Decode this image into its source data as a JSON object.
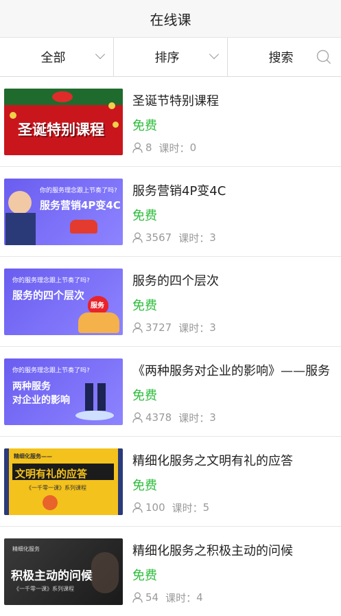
{
  "header": {
    "title": "在线课"
  },
  "filters": {
    "all_label": "全部",
    "sort_label": "排序",
    "search_label": "搜索"
  },
  "courses": [
    {
      "title": "圣诞节特别课程",
      "price": "免费",
      "students": "8",
      "lessons_label": "课时：",
      "lessons": "0",
      "thumb_text": "圣诞特别课程"
    },
    {
      "title": "服务营销4P变4C",
      "price": "免费",
      "students": "3567",
      "lessons_label": "课时：",
      "lessons": "3",
      "thumb_top": "你的服务理念跟上节奏了吗?",
      "thumb_text": "服务营销4P变4C"
    },
    {
      "title": "服务的四个层次",
      "price": "免费",
      "students": "3727",
      "lessons_label": "课时：",
      "lessons": "3",
      "thumb_top": "你的服务理念跟上节奏了吗?",
      "thumb_text": "服务的四个层次",
      "thumb_badge": "服务"
    },
    {
      "title": "《两种服务对企业的影响》——服务",
      "price": "免费",
      "students": "4378",
      "lessons_label": "课时：",
      "lessons": "3",
      "thumb_top": "你的服务理念跟上节奏了吗?",
      "thumb_text": "两种服务",
      "thumb_text2": "对企业的影响"
    },
    {
      "title": "精细化服务之文明有礼的应答",
      "price": "免费",
      "students": "100",
      "lessons_label": "课时：",
      "lessons": "5",
      "thumb_top": "精细化服务——",
      "thumb_text": "文明有礼的应答",
      "thumb_sub": "《一千零一课》系列课程"
    },
    {
      "title": "精细化服务之积极主动的问候",
      "price": "免费",
      "students": "54",
      "lessons_label": "课时：",
      "lessons": "4",
      "thumb_top": "精细化服务",
      "thumb_text": "积极主动的问候",
      "thumb_sub": "《一千零一课》系列课程"
    }
  ],
  "colors": {
    "free": "#2bbd3a",
    "muted": "#999999",
    "xmas_red": "#c9161d",
    "purple": "#6a5df0",
    "yellow": "#f4c21c"
  }
}
